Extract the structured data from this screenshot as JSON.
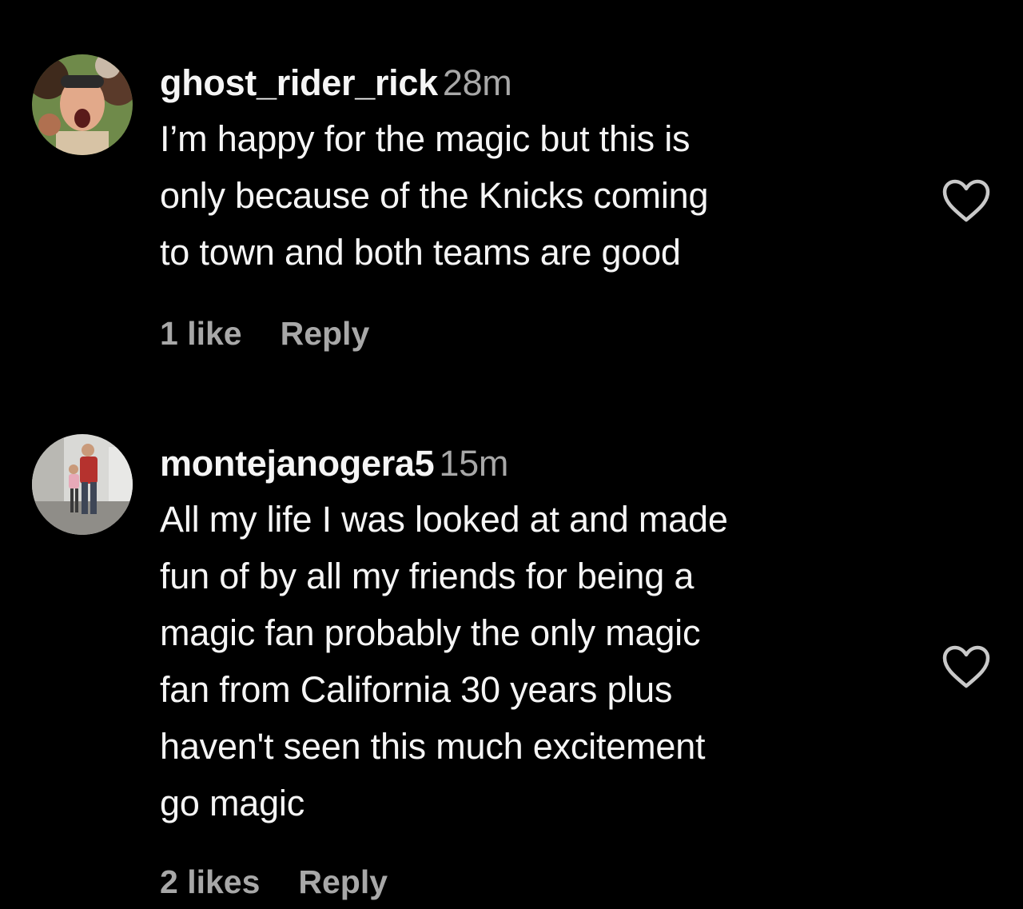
{
  "comments": [
    {
      "username": "ghost_rider_rick",
      "time": "28m",
      "text": "I’m happy for the magic but this is\nonly because of the Knicks coming\nto town and both teams are good",
      "likes": "1 like",
      "reply_label": "Reply",
      "avatar_icon": "avatar-photo-icon",
      "like_icon": "heart-outline-icon"
    },
    {
      "username": "montejanogera5",
      "time": "15m",
      "text": "All my life I was looked at and made\nfun of by all my friends for being a\nmagic fan probably the only magic\nfan from California 30 years plus\nhaven't seen this much excitement\ngo magic",
      "likes": "2 likes",
      "reply_label": "Reply",
      "avatar_icon": "avatar-photo-icon",
      "like_icon": "heart-outline-icon"
    }
  ],
  "colors": {
    "background": "#000000",
    "primary_text": "#f5f5f5",
    "secondary_text": "#a8a8a8"
  }
}
